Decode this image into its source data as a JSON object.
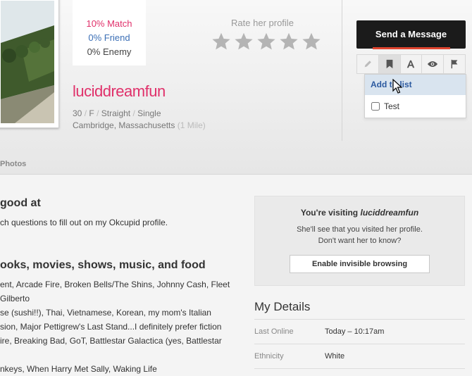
{
  "match": {
    "match_text": "10% Match",
    "friend_text": "0% Friend",
    "enemy_text": "0% Enemy"
  },
  "rating": {
    "label": "Rate her profile",
    "stars": 5
  },
  "profile": {
    "username": "luciddreamfun",
    "age": "30",
    "gender": "F",
    "orientation": "Straight",
    "status": "Single",
    "location": "Cambridge, Massachusetts",
    "distance": "(1 Mile)",
    "slash": "/"
  },
  "tabs": {
    "photos": "Photos"
  },
  "actions": {
    "send_message": "Send a Message",
    "icons": [
      "pencil-icon",
      "bookmark-icon",
      "font-icon",
      "eye-icon",
      "flag-icon"
    ]
  },
  "list_dropdown": {
    "header": "Add to list",
    "items": [
      {
        "label": "Test",
        "checked": false
      }
    ]
  },
  "main": {
    "good_at": {
      "title": "good at",
      "text": "ch questions to fill out on my Okcupid profile."
    },
    "favorites": {
      "title": "ooks, movies, shows, music, and food",
      "lines": [
        "ent, Arcade Fire, Broken Bells/The Shins, Johnny Cash, Fleet",
        "Gilberto",
        "se (sushi!!), Thai, Vietnamese, Korean, my mom's Italian",
        "sion, Major Pettigrew's Last Stand...I definitely prefer fiction",
        "ire, Breaking Bad, GoT, Battlestar Galactica (yes, Battlestar",
        "",
        "nkeys, When Harry Met Sally, Waking Life"
      ]
    }
  },
  "visiting": {
    "prefix": "You're visiting",
    "username": "luciddreamfun",
    "line1": "She'll see that you visited her profile.",
    "line2": "Don't want her to know?",
    "button": "Enable invisible browsing"
  },
  "details": {
    "title": "My Details",
    "rows": [
      {
        "label": "Last Online",
        "value": "Today – 10:17am"
      },
      {
        "label": "Ethnicity",
        "value": "White"
      }
    ]
  },
  "colors": {
    "accent_pink": "#e0306a",
    "friend_blue": "#3b6fb6",
    "link_blue": "#2c5aa0",
    "button_dark": "#1b1b1b",
    "button_accent": "#e0452f"
  }
}
